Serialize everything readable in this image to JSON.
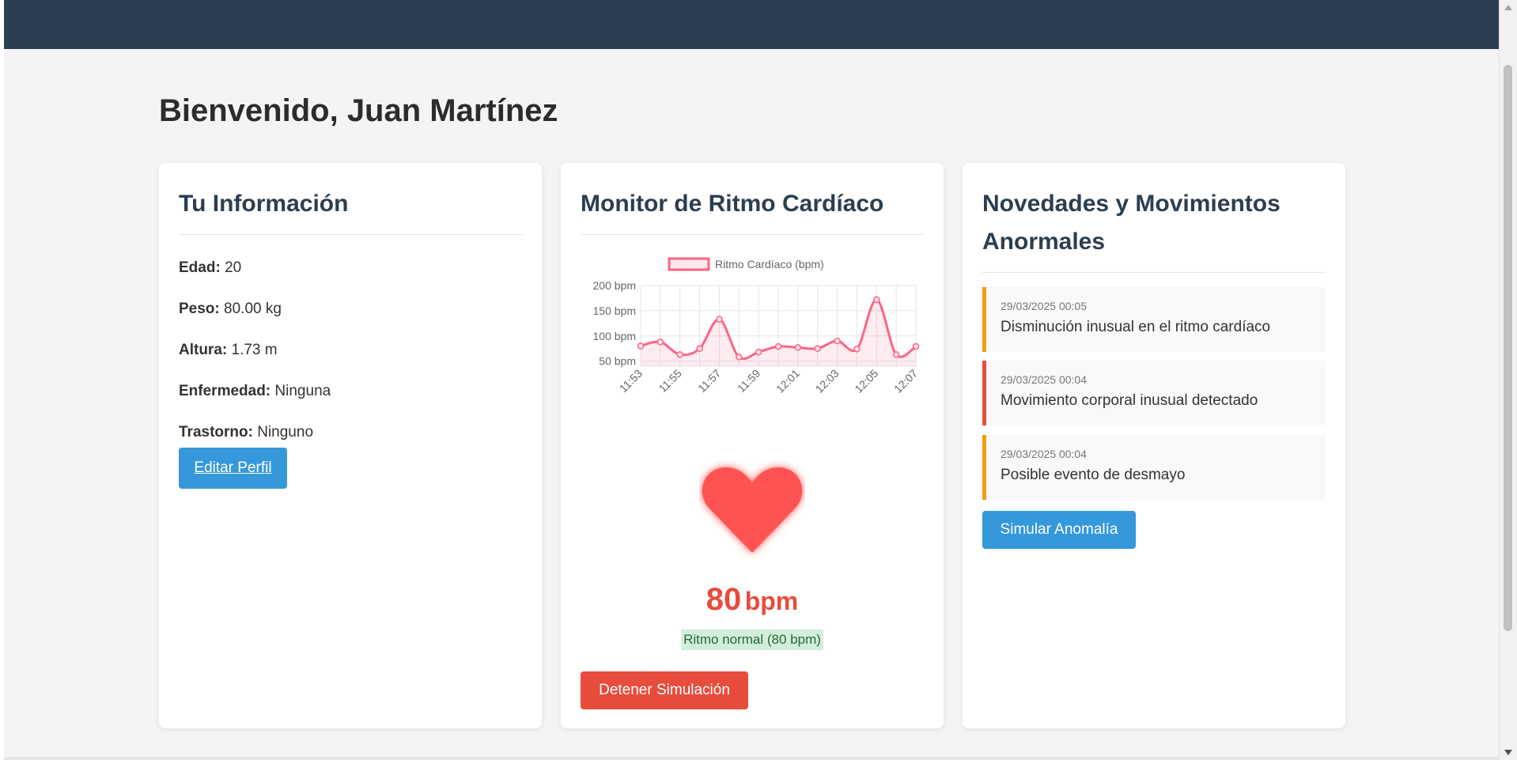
{
  "header": {
    "welcome": "Bienvenido, Juan Martínez"
  },
  "info_card": {
    "title": "Tu Información",
    "rows": [
      {
        "label": "Edad:",
        "value": "20"
      },
      {
        "label": "Peso:",
        "value": "80.00 kg"
      },
      {
        "label": "Altura:",
        "value": "1.73 m"
      },
      {
        "label": "Enfermedad:",
        "value": "Ninguna"
      },
      {
        "label": "Trastorno:",
        "value": "Ninguno"
      }
    ],
    "edit_button": "Editar Perfil"
  },
  "heart_card": {
    "title": "Monitor de Ritmo Cardíaco",
    "bpm_value": "80",
    "bpm_unit": "bpm",
    "status": "Ritmo normal (80 bpm)",
    "stop_button": "Detener Simulación",
    "heart_icon": "heart-icon",
    "heart_color": "#ff5252"
  },
  "chart_data": {
    "type": "line",
    "legend": "Ritmo Cardíaco (bpm)",
    "color": "#ff6384",
    "x": [
      "11:53",
      "",
      "11:55",
      "",
      "11:57",
      "",
      "11:59",
      "",
      "12:01",
      "",
      "12:03",
      "",
      "12:05",
      "",
      "12:07"
    ],
    "x_tick_labels": [
      "11:53",
      "11:55",
      "11:57",
      "11:59",
      "12:01",
      "12:03",
      "12:05",
      "12:07"
    ],
    "values": [
      80,
      88,
      63,
      75,
      133,
      58,
      68,
      79,
      77,
      75,
      90,
      74,
      172,
      63,
      79
    ],
    "y_ticks": [
      "200 bpm",
      "150 bpm",
      "100 bpm",
      "50 bpm"
    ],
    "ylim": [
      40,
      200
    ],
    "grid": true,
    "legend_position": "top"
  },
  "news_card": {
    "title_line1": "Novedades y Movimientos",
    "title_line2": "Anormales",
    "alerts": [
      {
        "time": "29/03/2025 00:05",
        "message": "Disminución inusual en el ritmo cardíaco",
        "color": "#f39c12"
      },
      {
        "time": "29/03/2025 00:04",
        "message": "Movimiento corporal inusual detectado",
        "color": "#e74c3c"
      },
      {
        "time": "29/03/2025 00:04",
        "message": "Posible evento de desmayo",
        "color": "#f39c12"
      }
    ],
    "simulate_button": "Simular Anomalía"
  }
}
